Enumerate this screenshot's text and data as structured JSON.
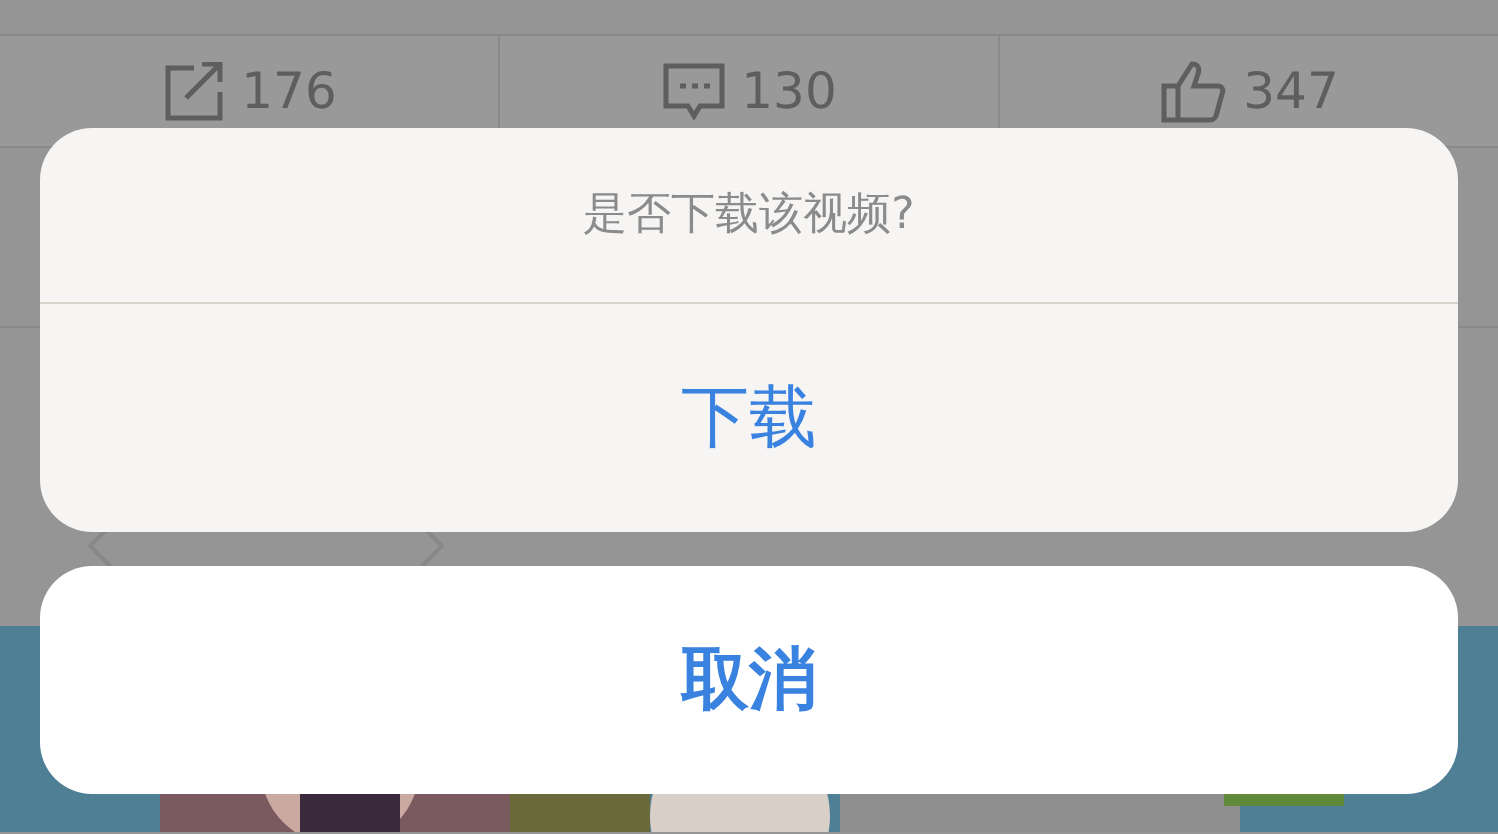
{
  "stats": [
    {
      "kind": "share",
      "count": "176"
    },
    {
      "kind": "comment",
      "count": "130"
    },
    {
      "kind": "like",
      "count": "347"
    }
  ],
  "action_sheet": {
    "title": "是否下载该视频?",
    "actions": [
      "下载"
    ],
    "cancel": "取消"
  }
}
